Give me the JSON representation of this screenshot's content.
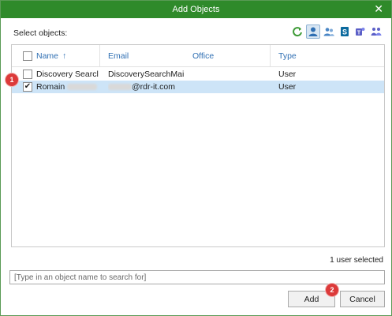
{
  "window": {
    "title": "Add Objects"
  },
  "select_label": "Select objects:",
  "toolbar": {
    "icons": [
      "refresh-icon",
      "user-icon",
      "group-icon",
      "sharepoint-icon",
      "teams-icon",
      "team-users-icon"
    ],
    "active_icon": "user-icon",
    "colors": {
      "green": "#2f8a2a",
      "blue": "#2f6fb3",
      "teams": "#5b5fc7",
      "sharepoint": "#0b6a9e"
    }
  },
  "table": {
    "columns": {
      "name": "Name",
      "sort_indicator": "↑",
      "email": "Email",
      "office": "Office",
      "type": "Type"
    },
    "rows": [
      {
        "name": "Discovery Searcl",
        "email": "DiscoverySearchMai",
        "office": "",
        "type": "User",
        "checked": false
      },
      {
        "name": "Romain",
        "email": "@rdr-it.com",
        "office": "",
        "type": "User",
        "checked": true
      }
    ]
  },
  "status": "1 user selected",
  "search": {
    "placeholder": "[Type in an object name to search for]"
  },
  "buttons": {
    "add": "Add",
    "cancel": "Cancel"
  },
  "markers": {
    "one": "1",
    "two": "2"
  }
}
